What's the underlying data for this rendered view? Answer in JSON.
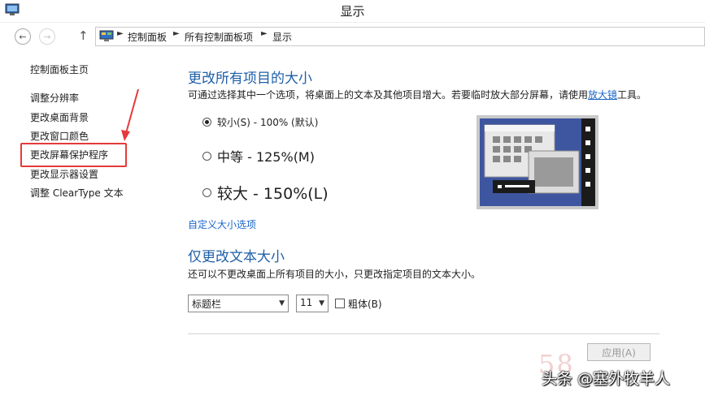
{
  "window": {
    "title": "显示"
  },
  "breadcrumb": [
    "控制面板",
    "所有控制面板项",
    "显示"
  ],
  "sidebar": {
    "home": "控制面板主页",
    "items": [
      "调整分辨率",
      "更改桌面背景",
      "更改窗口颜色",
      "更改屏幕保护程序",
      "更改显示器设置",
      "调整 ClearType 文本"
    ]
  },
  "size_section": {
    "title": "更改所有项目的大小",
    "description": "可通过选择其中一个选项，将桌面上的文本及其他项目增大。若要临时放大部分屏幕，请使用",
    "magnifier_link": "放大镜",
    "description_end": "工具。",
    "options": [
      {
        "label": "较小(S) - 100% (默认)",
        "checked": true
      },
      {
        "label": "中等 - 125%(M)",
        "checked": false
      },
      {
        "label": "较大 - 150%(L)",
        "checked": false
      }
    ],
    "custom_link": "自定义大小选项"
  },
  "text_section": {
    "title": "仅更改文本大小",
    "description": "还可以不更改桌面上所有项目的大小，只更改指定项目的文本大小。",
    "element_select": "标题栏",
    "size_select": "11",
    "bold_label": "粗体(B)",
    "bold_checked": false
  },
  "apply_button": "应用(A)",
  "watermark": {
    "number": "58",
    "text": "头条 @塞外牧羊人"
  },
  "colors": {
    "accent_title": "#1f5fa8",
    "link": "#1a66c8",
    "highlight": "#e53a3a"
  }
}
